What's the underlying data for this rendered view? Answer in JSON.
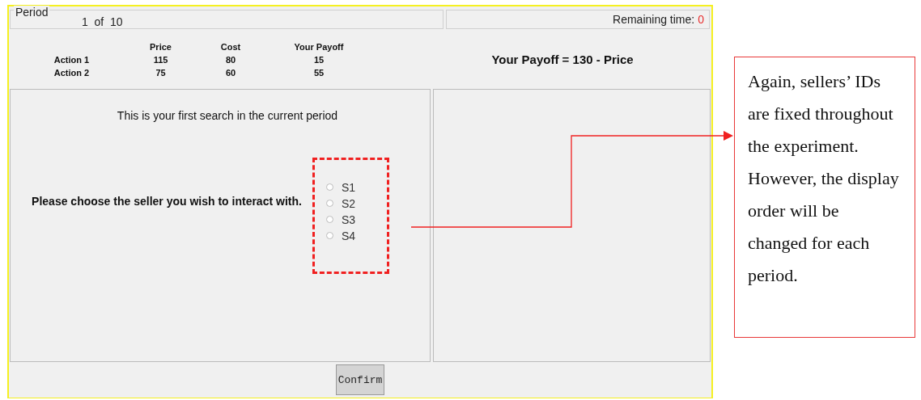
{
  "header": {
    "period_label": "Period",
    "period_value": "1  of  10",
    "remaining_label": "Remaining time:",
    "remaining_value": "0"
  },
  "payoff_table": {
    "columns": [
      "Price",
      "Cost",
      "Your Payoff"
    ],
    "rows": [
      {
        "label": "Action 1",
        "cells": [
          "115",
          "80",
          "15"
        ]
      },
      {
        "label": "Action 2",
        "cells": [
          "75",
          "60",
          "55"
        ]
      }
    ]
  },
  "payoff_formula": "Your Payoff = 130 - Price",
  "left_panel": {
    "notice": "This is your first search in the current period",
    "prompt": "Please choose the seller you wish to interact with.",
    "sellers": [
      {
        "label": "S1",
        "selected": false
      },
      {
        "label": "S2",
        "selected": false
      },
      {
        "label": "S3",
        "selected": false
      },
      {
        "label": "S4",
        "selected": false
      }
    ]
  },
  "confirm_button": "Confirm",
  "annotation": {
    "text": "Again, sellers’ IDs are fixed throughout the experiment. However, the display order will be changed for each period."
  }
}
